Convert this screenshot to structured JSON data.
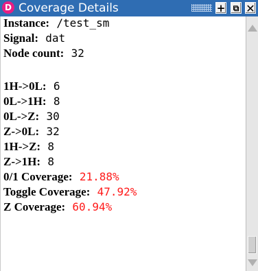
{
  "window": {
    "title": "Coverage Details",
    "app_icon_letter": "D",
    "buttons": {
      "plus": "+",
      "undock": "⧉",
      "close": "✕"
    }
  },
  "details": [
    {
      "label": "Instance:",
      "value": "/test_sm",
      "color": "#000000"
    },
    {
      "label": "Signal:",
      "value": "dat",
      "color": "#000000"
    },
    {
      "label": "Node count:",
      "value": "32",
      "color": "#000000"
    },
    {
      "label": "",
      "value": "",
      "color": "#000000"
    },
    {
      "label": "1H->0L:",
      "value": "6",
      "color": "#000000"
    },
    {
      "label": "0L->1H:",
      "value": "8",
      "color": "#000000"
    },
    {
      "label": "0L->Z:",
      "value": "30",
      "color": "#000000"
    },
    {
      "label": "Z->0L:",
      "value": "32",
      "color": "#000000"
    },
    {
      "label": "1H->Z:",
      "value": "8",
      "color": "#000000"
    },
    {
      "label": "Z->1H:",
      "value": "8",
      "color": "#000000"
    },
    {
      "label": "0/1 Coverage:",
      "value": "21.88%",
      "color": "#ff1a1a"
    },
    {
      "label": "Toggle Coverage:",
      "value": "47.92%",
      "color": "#ff1a1a"
    },
    {
      "label": "Z Coverage:",
      "value": "60.94%",
      "color": "#ff1a1a"
    }
  ],
  "colors": {
    "titlebar": "#2f6db3",
    "app_icon": "#e81e83",
    "coverage_value": "#ff1a1a"
  }
}
